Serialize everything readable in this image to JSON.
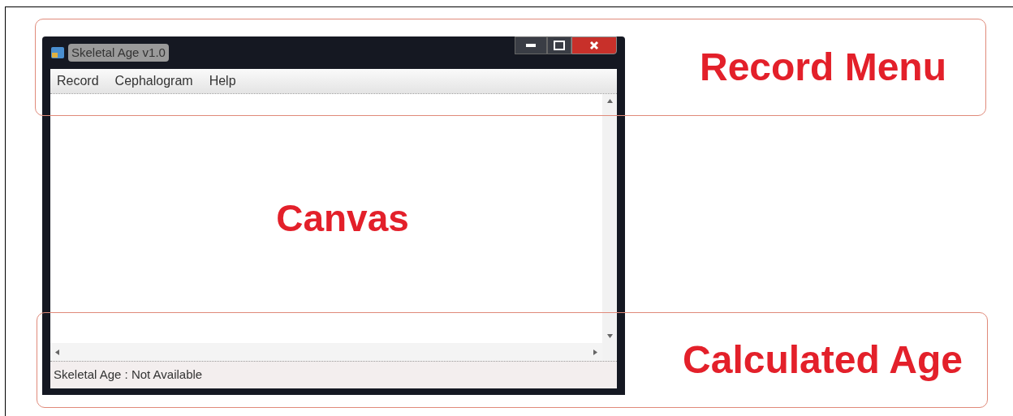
{
  "window": {
    "title": "Skeletal Age v1.0"
  },
  "menu": [
    {
      "label": "Record"
    },
    {
      "label": "Cephalogram"
    },
    {
      "label": "Help"
    }
  ],
  "canvas_label": "Canvas",
  "status_bar": "Skeletal Age : Not Available",
  "annotations": [
    {
      "kind": "top",
      "label": "Record Menu"
    },
    {
      "kind": "bottom",
      "label": "Calculated Age"
    }
  ]
}
